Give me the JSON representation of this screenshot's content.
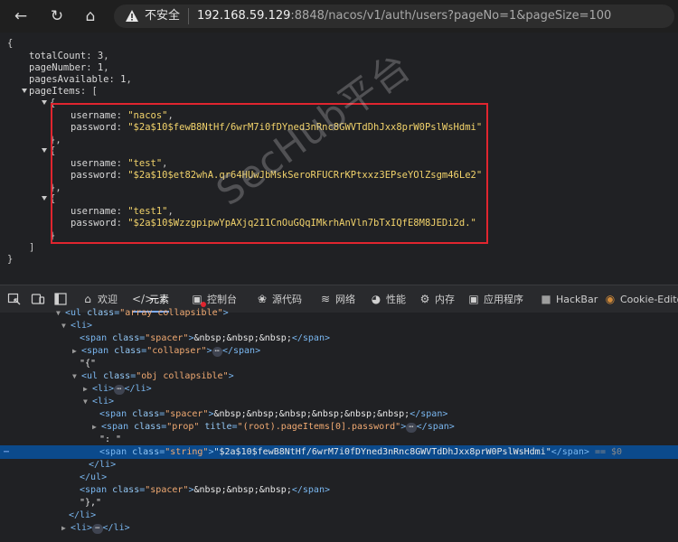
{
  "browser": {
    "insecure_label": "不安全",
    "url_host": "192.168.59.129",
    "url_rest": ":8848/nacos/v1/auth/users?pageNo=1&pageSize=100"
  },
  "json_view": {
    "open_brace": "{",
    "close_brace": "}",
    "totalCount_key": "totalCount",
    "totalCount": "3",
    "pageNumber_key": "pageNumber",
    "pageNumber": "1",
    "pagesAvailable_key": "pagesAvailable",
    "pagesAvailable": "1",
    "pageItems_key": "pageItems",
    "items": [
      {
        "username": "\"nacos\"",
        "password": "\"$2a$10$fewB8NtHf/6wrM7i0fDYned3nRnc8GWVTdDhJxx8prW0PslWsHdmi\""
      },
      {
        "username": "\"test\"",
        "password": "\"$2a$10$et82whA.qr64HUwJbMskSeroRFUCRrKPtxxz3EPseYOlZsgm46Le2\""
      },
      {
        "username": "\"test1\"",
        "password": "\"$2a$10$WzzgpipwYpAXjq2I1CnOuGQqIMkrhAnVln7bTxIQfE8M8JEDi2d.\""
      }
    ]
  },
  "watermark": "SecHub平台",
  "devtools": {
    "tabs": [
      "欢迎",
      "元素",
      "控制台",
      "源代码",
      "网络",
      "性能",
      "内存",
      "应用程序",
      "HackBar",
      "Cookie-Editor"
    ],
    "selected_suffix": "== $0",
    "selected_password": "\"$2a$10$fewB8NtHf/6wrM7i0fDYned3nRnc8GWVTdDhJxx8prW0PslWsHdmi\"",
    "root_title": "(root).pageItems[0].password"
  }
}
